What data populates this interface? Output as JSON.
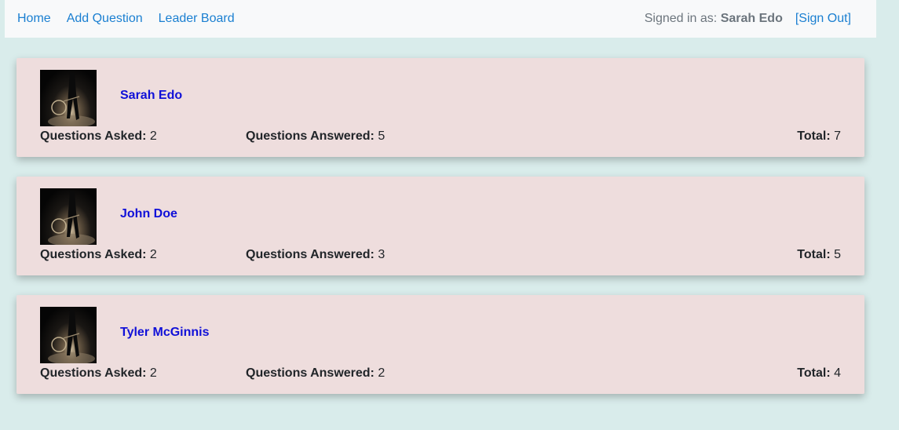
{
  "nav": {
    "links": [
      "Home",
      "Add Question",
      "Leader Board"
    ],
    "signed_in_prefix": "Signed in as:",
    "signed_in_user": "Sarah Edo",
    "sign_out": "[Sign Out]"
  },
  "labels": {
    "asked": "Questions Asked:",
    "answered": "Questions Answered:",
    "total": "Total:"
  },
  "leaders": [
    {
      "name": "Sarah Edo",
      "asked": "2",
      "answered": "5",
      "total": "7",
      "avatar_icon": "avatar-photo-icon"
    },
    {
      "name": "John Doe",
      "asked": "2",
      "answered": "3",
      "total": "5",
      "avatar_icon": "avatar-photo-icon"
    },
    {
      "name": "Tyler McGinnis",
      "asked": "2",
      "answered": "2",
      "total": "4",
      "avatar_icon": "avatar-photo-icon"
    }
  ],
  "colors": {
    "background": "#d9eceb",
    "card": "#eedddd",
    "link": "#1a7fd1",
    "name": "#1010d8"
  }
}
